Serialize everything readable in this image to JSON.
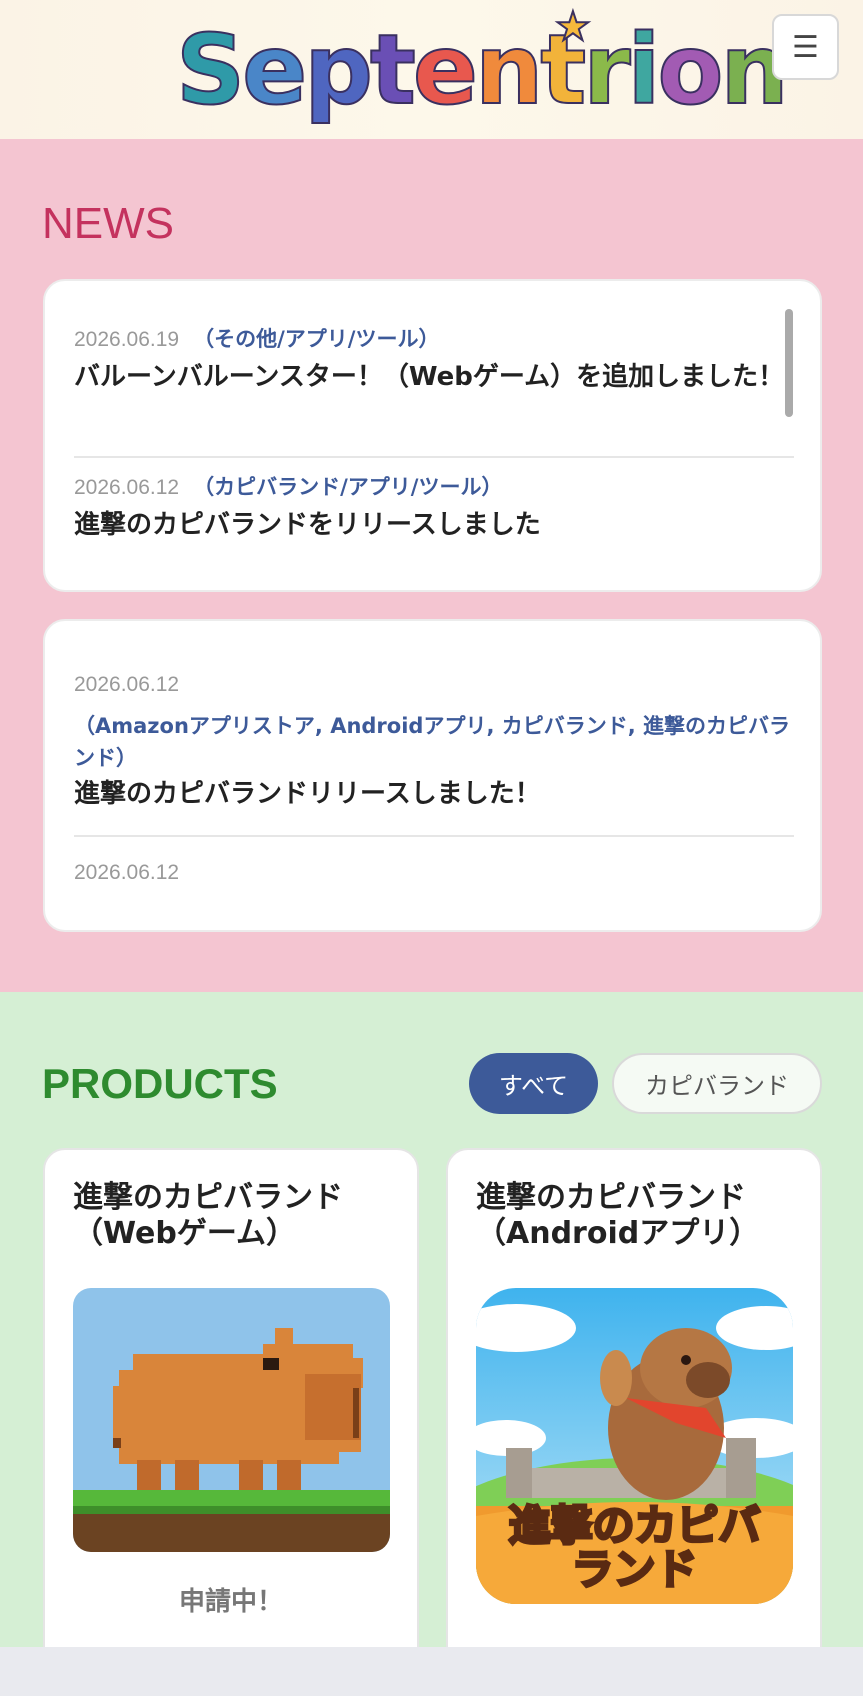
{
  "header": {
    "logo_text": "Septentrion",
    "menu_icon": "hamburger-icon",
    "menu_glyph": "☰"
  },
  "news": {
    "title": "NEWS",
    "items": [
      {
        "date": "2026.06.19",
        "category": "（その他/アプリ/ツール）",
        "title": "バルーンバルーンスター！（Webゲーム）を追加しました！"
      },
      {
        "date": "2026.06.12",
        "category": "（カピバランド/アプリ/ツール）",
        "title": "進撃のカピバランドをリリースしました"
      },
      {
        "date": "2026.06.12",
        "category": "（Amazonアプリストア, Androidアプリ, カピバランド, 進撃のカピバランド）",
        "title": "進撃のカピバランドリリースしました！"
      },
      {
        "date": "2026.06.12",
        "category": "",
        "title": ""
      }
    ]
  },
  "products": {
    "title": "PRODUCTS",
    "filters": [
      "すべて",
      "カピバランド"
    ],
    "active_filter": "すべて",
    "cards": [
      {
        "title": "進撃のカピバランド（Webゲーム）",
        "image": "pixel-capybara-image",
        "status": "申請中！"
      },
      {
        "title": "進撃のカピバランド（Androidアプリ）",
        "image": "capybara-app-icon-image",
        "overlay_text": "進撃のカピバランド"
      }
    ]
  },
  "colors": {
    "news_bg": "#f4c5d1",
    "news_title": "#c4325e",
    "products_bg": "#d5efd4",
    "products_title": "#2e8b2f",
    "accent_blue": "#3d5a99"
  }
}
